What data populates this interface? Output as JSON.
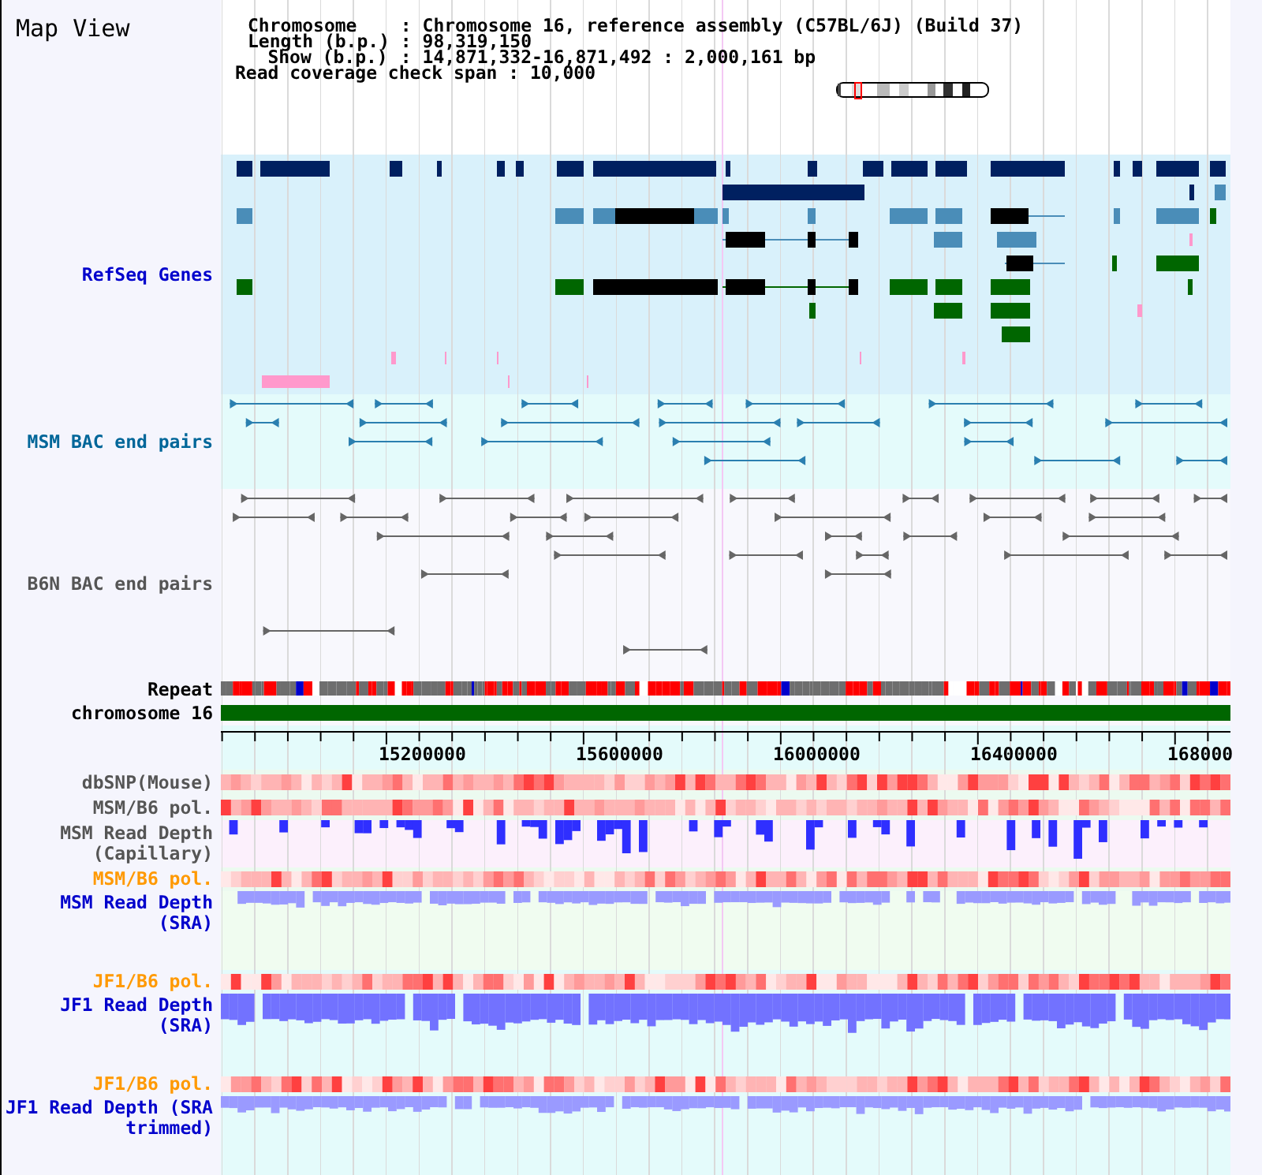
{
  "title": "Map View",
  "info": [
    {
      "kind": "aligned",
      "label": "Chromosome",
      "separator": ":",
      "value": "Chromosome 16, reference assembly (C57BL/6J) (Build 37)"
    },
    {
      "kind": "aligned",
      "label": "Length (b.p.)",
      "separator": ":",
      "value": "98,319,150"
    },
    {
      "kind": "indented",
      "label": "Show (b.p.)",
      "separator": ":",
      "value": "14,871,332-16,871,492 : 2,000,161 bp"
    },
    {
      "kind": "inline",
      "label": "Read coverage check span",
      "separator": ":",
      "value": "10,000"
    }
  ],
  "tracks": [
    {
      "kind": "genes",
      "label": "RefSeq Genes",
      "color": "#0000cc"
    },
    {
      "kind": "bac",
      "label": "MSM BAC end pairs",
      "color": "#006699"
    },
    {
      "kind": "bac",
      "label": "B6N BAC end pairs",
      "color": "#555555"
    },
    {
      "kind": "repeat",
      "label": "Repeat",
      "color": "#000000"
    },
    {
      "kind": "chromosome",
      "label": "chromosome 16",
      "color": "#000000"
    },
    {
      "kind": "ruler",
      "labels": [
        "15200000",
        "15600000",
        "16000000",
        "16400000",
        "168000"
      ]
    },
    {
      "kind": "heat",
      "label": "dbSNP(Mouse)",
      "color": "#555555"
    },
    {
      "kind": "heat",
      "label": "MSM/B6 pol.",
      "color": "#555555"
    },
    {
      "kind": "depth",
      "label": "MSM Read Depth (Capillary)",
      "color": "#555555"
    },
    {
      "kind": "heat",
      "label": "MSM/B6 pol.",
      "color": "#ff9900"
    },
    {
      "kind": "depth",
      "label": "MSM Read Depth (SRA)",
      "color": "#0000cc"
    },
    {
      "kind": "heat",
      "label": "JF1/B6 pol.",
      "color": "#ff9900"
    },
    {
      "kind": "depth",
      "label": "JF1 Read Depth (SRA)",
      "color": "#0000cc"
    },
    {
      "kind": "heat",
      "label": "JF1/B6 pol.",
      "color": "#ff9900"
    },
    {
      "kind": "depth",
      "label": "JF1 Read Depth (SRA trimmed)",
      "color": "#0000cc"
    }
  ]
}
